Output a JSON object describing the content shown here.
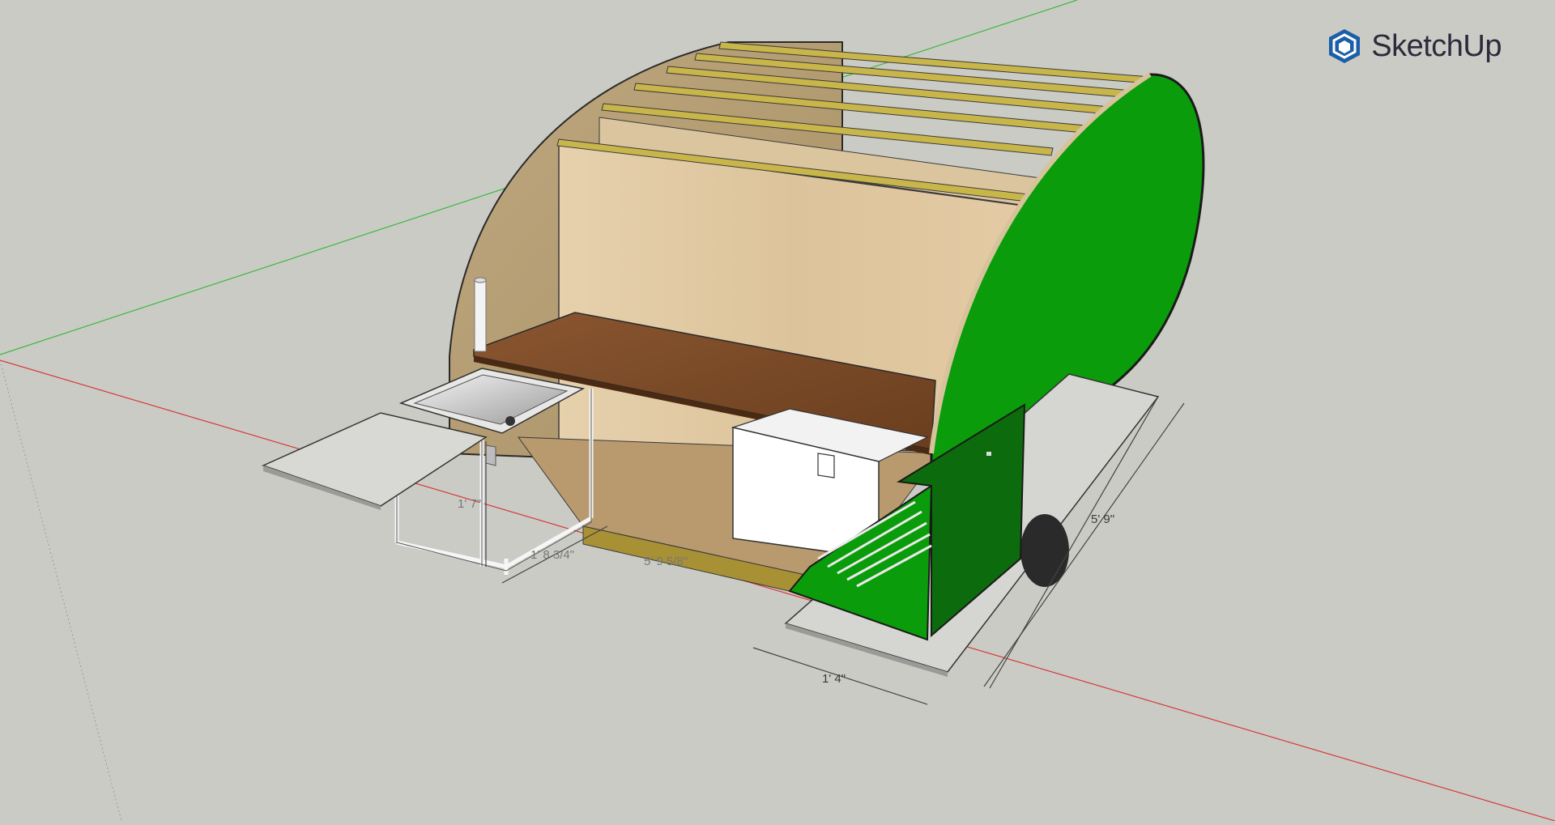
{
  "app": {
    "brand_name": "SketchUp",
    "logo_icon": "sketchup-logo-icon"
  },
  "scene": {
    "description_free": true,
    "colors": {
      "background": "#cbcbc6",
      "green_axis": "#3bb83b",
      "red_axis": "#d43a3a",
      "green_panel": "#0a9c0a",
      "dark_green_panel": "#0c6b0c",
      "plywood": "#e2cba8",
      "countertop": "#7a4a26",
      "floor": "#b89a6e",
      "slats": "#c9b64a",
      "brand_text": "#2b2b3c",
      "brand_icon": "#1b5fa8"
    }
  },
  "dimensions": {
    "length": "5' 9\"",
    "width": "1' 4\"",
    "floor": "5' 9 5/8\"",
    "sink_depth": "1' 8 3/4\"",
    "sink_height": "1' 7\""
  }
}
